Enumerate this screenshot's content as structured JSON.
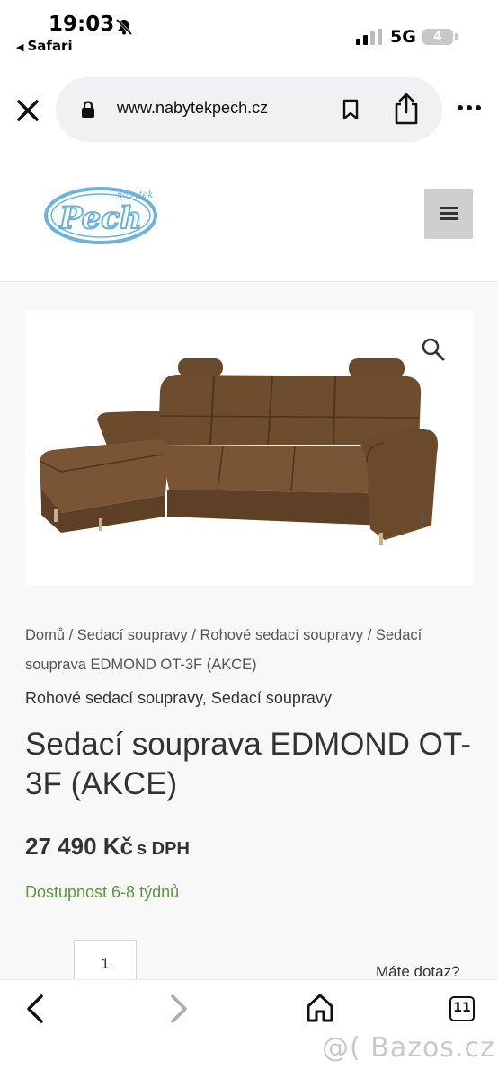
{
  "status_bar": {
    "time": "19:03",
    "back_app": "Safari",
    "network": "5G",
    "battery": "4"
  },
  "browser": {
    "url": "www.nabytekpech.cz"
  },
  "site": {
    "logo_small": "nábytek",
    "logo_main": "Pech"
  },
  "breadcrumb": {
    "items": [
      "Domů",
      "Sedací soupravy",
      "Rohové sedací soupravy",
      "Sedací souprava EDMOND OT-3F (AKCE)"
    ],
    "separator": "/"
  },
  "product": {
    "categories": [
      "Rohové sedací soupravy",
      "Sedací soupravy"
    ],
    "category_separator": ",",
    "title": "Sedací souprava EDMOND OT-3F (AKCE)",
    "price": "27 490 Kč",
    "price_suffix": "s DPH",
    "availability": "Dostupnost 6-8 týdnů",
    "availability_color": "#5a9a3c",
    "quantity": "1",
    "question_link": "Máte dotaz?"
  },
  "toolbar": {
    "tabs_count": "11"
  },
  "watermark": "@( Bazos.cz",
  "icons": {
    "close": "close-icon",
    "lock": "lock-icon",
    "bookmark": "bookmark-icon",
    "share": "share-icon",
    "more": "more-icon",
    "menu": "hamburger-menu-icon",
    "zoom": "magnifier-icon",
    "back": "chevron-left-icon",
    "forward": "chevron-right-icon",
    "home": "home-icon",
    "tabs": "tabs-icon"
  },
  "colors": {
    "logo_blue": "#6bb3d9",
    "sofa_brown": "#6b4a2c"
  }
}
